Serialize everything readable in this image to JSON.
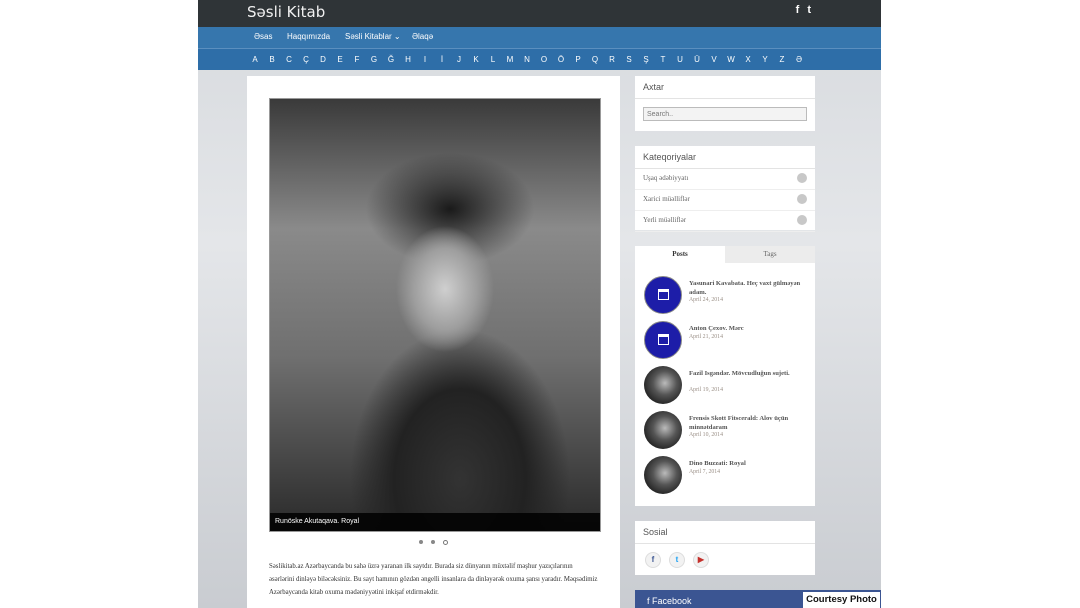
{
  "site": {
    "brand": "Səsli Kitab",
    "social_top": [
      "f",
      "t"
    ]
  },
  "nav": {
    "items": [
      "Əsas",
      "Haqqımızda",
      "Səsli Kitablar ⌄",
      "Əlaqə"
    ]
  },
  "alphabet": [
    "A",
    "B",
    "C",
    "Ç",
    "D",
    "E",
    "F",
    "G",
    "Ğ",
    "H",
    "I",
    "İ",
    "J",
    "K",
    "L",
    "M",
    "N",
    "O",
    "Ö",
    "P",
    "Q",
    "R",
    "S",
    "Ş",
    "T",
    "U",
    "Ü",
    "V",
    "W",
    "X",
    "Y",
    "Z",
    "Ə"
  ],
  "slider": {
    "caption": "Runöske Akutaqava. Royal"
  },
  "intro_text": "Səslikitab.az Azərbaycanda bu sahə üzrə yaranan ilk saytdır. Burada siz dünyanın müxtəlif məşhur yazıçılarının əsərlərini dinləyə biləcəksiniz. Bu sayt hamının gözdən əngelli insanlara da dinləyərək oxuma şansı yaradır. Məqsədimiz Azərbaycanda kitab oxuma mədəniyyətini inkişaf etdirməkdir.",
  "search_widget": {
    "title": "Axtar",
    "placeholder": "Search.."
  },
  "categories_widget": {
    "title": "Kateqoriyalar",
    "items": [
      {
        "label": "Uşaq ədəbiyyatı"
      },
      {
        "label": "Xarici müəlliflər"
      },
      {
        "label": "Yerli müəlliflər"
      }
    ]
  },
  "posts_widget": {
    "tab_posts": "Posts",
    "tab_tags": "Tags",
    "posts": [
      {
        "title": "Yasunari Kavabata. Heç vaxt gülməyən adam.",
        "date": "April 24, 2014"
      },
      {
        "title": "Anton Çexov. Mərc",
        "date": "April 21, 2014"
      },
      {
        "title": "Fazil Isgəndər. Mövcudluğun sujeti.",
        "date": "April 19, 2014"
      },
      {
        "title": "Frensis Skott Fitscerald: Alov üçün minnətdaram",
        "date": "April 10, 2014"
      },
      {
        "title": "Dino Buzzati: Royal",
        "date": "April 7, 2014"
      }
    ]
  },
  "social_widget": {
    "title": "Sosial",
    "icons": [
      "f",
      "t",
      "▶"
    ]
  },
  "facebook_label": "Facebook",
  "courtesy": "Courtesy Photo",
  "colors": {
    "topbar": "#2f3437",
    "nav": "#3676ad",
    "post_icon": "#1d1da8",
    "facebook": "#3b5592"
  }
}
